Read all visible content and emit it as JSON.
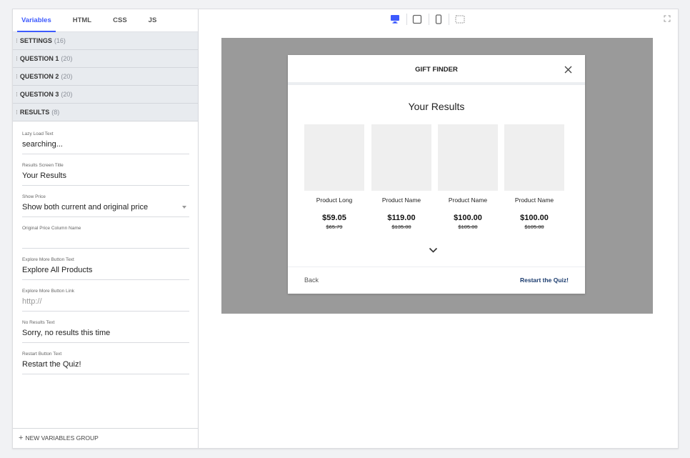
{
  "tabs": [
    "Variables",
    "HTML",
    "CSS",
    "JS"
  ],
  "groups": [
    {
      "name": "SETTINGS",
      "count": "(16)"
    },
    {
      "name": "QUESTION 1",
      "count": "(20)"
    },
    {
      "name": "QUESTION 2",
      "count": "(20)"
    },
    {
      "name": "QUESTION 3",
      "count": "(20)"
    },
    {
      "name": "RESULTS",
      "count": "(8)"
    }
  ],
  "fields": [
    {
      "label": "Lazy Load Text",
      "value": "searching..."
    },
    {
      "label": "Results Screen Title",
      "value": "Your Results"
    },
    {
      "label": "Show Price",
      "value": "Show both current and original price"
    },
    {
      "label": "Original Price Column Name",
      "value": ""
    },
    {
      "label": "Explore More Button Text",
      "value": "Explore All Products"
    },
    {
      "label": "Explore More Button Link",
      "value": "",
      "placeholder": "http://"
    },
    {
      "label": "No Results Text",
      "value": "Sorry, no results this time"
    },
    {
      "label": "Restart Button Text",
      "value": "Restart the Quiz!"
    }
  ],
  "new_group_label": "NEW VARIABLES GROUP",
  "toolbar": {
    "icons": [
      "desktop-icon",
      "tablet-icon",
      "mobile-icon",
      "custom-size-icon",
      "expand-icon"
    ],
    "active_color": "#3d5afe"
  },
  "modal": {
    "title": "GIFT FINDER",
    "results_title": "Your Results",
    "products": [
      {
        "name": "Product Long",
        "price": "$59.05",
        "original": "$65.79"
      },
      {
        "name": "Product Name",
        "price": "$119.00",
        "original": "$135.00"
      },
      {
        "name": "Product Name",
        "price": "$100.00",
        "original": "$105.00"
      },
      {
        "name": "Product Name",
        "price": "$100.00",
        "original": "$105.00"
      }
    ],
    "back_label": "Back",
    "restart_label": "Restart the Quiz!"
  }
}
